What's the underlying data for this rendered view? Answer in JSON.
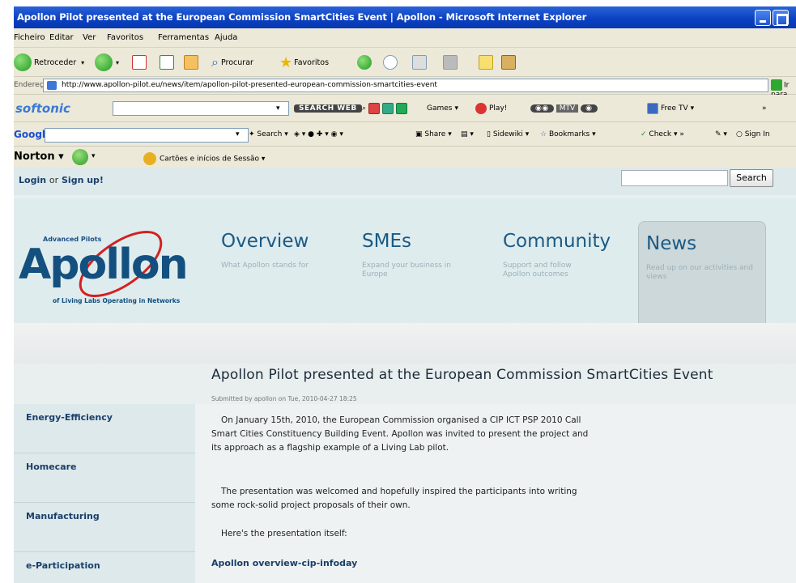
{
  "window": {
    "title": "Apollon Pilot presented at the European Commission SmartCities Event | Apollon - Microsoft Internet Explorer"
  },
  "menu": [
    "Ficheiro",
    "Editar",
    "Ver",
    "Favoritos",
    "Ferramentas",
    "Ajuda"
  ],
  "toolbar": {
    "back": "Retroceder",
    "search": "Procurar",
    "favorites": "Favoritos"
  },
  "address": {
    "label": "Endereço",
    "url": "http://www.apollon-pilot.eu/news/item/apollon-pilot-presented-european-commission-smartcities-event",
    "go": "Ir para"
  },
  "softonic": {
    "logo": "softonic",
    "search_button": "SEARCH WEB",
    "games": "Games",
    "play": "Play!",
    "mtv": "MTV",
    "freetv": "Free TV"
  },
  "google": {
    "logo": "Google",
    "search": "Search",
    "share": "Share",
    "sidewiki": "Sidewiki",
    "bookmarks": "Bookmarks",
    "check": "Check",
    "signin": "Sign In"
  },
  "norton": {
    "logo": "Norton",
    "cards": "Cartões e inícios de Sessão"
  },
  "page": {
    "login": "Login",
    "or": "or",
    "signup": "Sign up!",
    "search_button": "Search",
    "logo": {
      "top": "Advanced Pilots",
      "word": "Apollon",
      "bottom": "of Living Labs Operating in Networks"
    },
    "nav": [
      {
        "title": "Overview",
        "desc": "What Apollon stands for"
      },
      {
        "title": "SMEs",
        "desc": "Expand your business in Europe"
      },
      {
        "title": "Community",
        "desc": "Support and follow Apollon outcomes"
      },
      {
        "title": "News",
        "desc": "Read up on our activities and views"
      }
    ],
    "article_title": "Apollon Pilot presented at the European Commission SmartCities Event",
    "submitted": "Submitted by apollon on Tue, 2010-04-27 18:25",
    "sidebar": [
      "Energy-Efficiency",
      "Homecare",
      "Manufacturing",
      "e-Participation"
    ],
    "paragraphs": [
      "On January 15th, 2010, the European Commission organised a CIP ICT PSP 2010 Call Smart Cities Constituency Building Event. Apollon was invited to present the project and its approach as a flagship example of a Living Lab pilot.",
      "The presentation was welcomed and hopefully inspired the participants into writing some rock-solid project proposals of their own.",
      "Here's the presentation itself:"
    ],
    "presentation_title": "Apollon overview-cip-infoday"
  }
}
